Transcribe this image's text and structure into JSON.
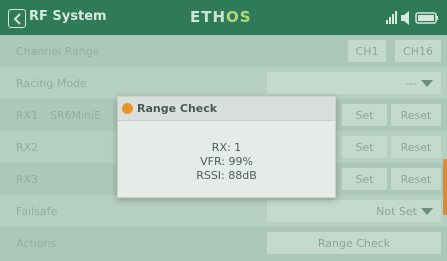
{
  "header": {
    "title": "RF System",
    "logo_a": "ETH",
    "logo_b": "OS",
    "icons": [
      "signal-icon",
      "volume-icon",
      "battery-icon"
    ]
  },
  "rows": {
    "channel_range": {
      "label": "Channel Range",
      "from": "CH1",
      "to": "CH16"
    },
    "racing_mode": {
      "label": "Racing Mode",
      "value": "---"
    },
    "rx1": {
      "label": "RX1",
      "model": "SR6MiniE",
      "set": "Set",
      "reset": "Reset"
    },
    "rx2": {
      "label": "RX2",
      "set": "Set",
      "reset": "Reset"
    },
    "rx3": {
      "label": "RX3",
      "set": "Set",
      "reset": "Reset"
    },
    "failsafe": {
      "label": "Failsafe",
      "value": "Not Set"
    },
    "actions": {
      "label": "Actions",
      "button": "Range Check"
    }
  },
  "dialog": {
    "title": "Range Check",
    "rx": "RX: 1",
    "vfr": "VFR: 99%",
    "rssi": "RSSI: 88dB"
  },
  "colors": {
    "header": "#2f7b59",
    "dimmed_background": "#acc8b8",
    "warning": "#e8962a"
  }
}
